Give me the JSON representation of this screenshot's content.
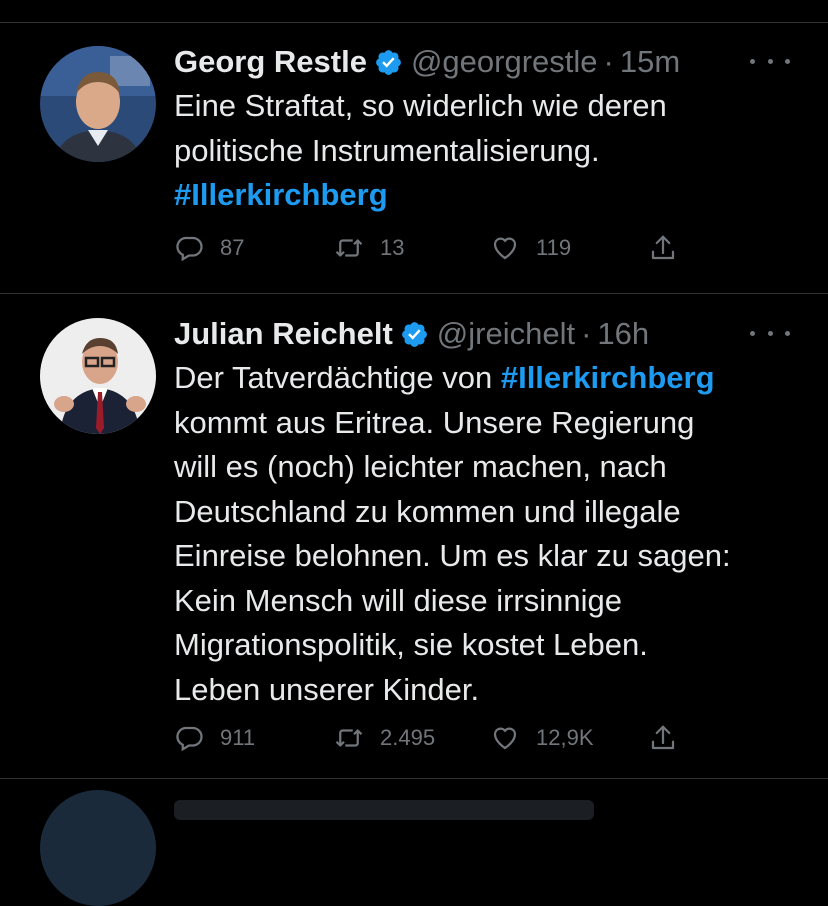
{
  "colors": {
    "background": "#000000",
    "text": "#e7e9ea",
    "muted": "#71767b",
    "accent": "#1d9bf0",
    "divider": "#2f3336"
  },
  "tweets": [
    {
      "name": "Georg Restle",
      "handle": "@georgrestle",
      "separator": "·",
      "time": "15m",
      "verified_icon": "verified-badge-icon",
      "body": {
        "line1": "Eine Straftat, so widerlich wie deren",
        "line2": "politische Instrumentalisierung.",
        "hashtag": "#Illerkirchberg"
      },
      "actions": {
        "reply_icon": "reply-icon",
        "replies": "87",
        "retweet_icon": "retweet-icon",
        "retweets": "13",
        "like_icon": "heart-icon",
        "likes": "119",
        "share_icon": "share-icon"
      }
    },
    {
      "name": "Julian Reichelt",
      "handle": "@jreichelt",
      "separator": "·",
      "time": "16h",
      "verified_icon": "verified-badge-icon",
      "body": {
        "line1_prefix": "Der Tatverdächtige von ",
        "line1_hashtag": "#Illerkirchberg",
        "line2": "kommt aus Eritrea. Unsere Regierung",
        "line3": "will es (noch) leichter machen, nach",
        "line4": "Deutschland zu kommen und illegale",
        "line5": "Einreise belohnen. Um es klar zu sagen:",
        "line6": "Kein Mensch will diese irrsinnige",
        "line7": "Migrationspolitik, sie kostet Leben.",
        "line8": "Leben unserer Kinder."
      },
      "actions": {
        "reply_icon": "reply-icon",
        "replies": "911",
        "retweet_icon": "retweet-icon",
        "retweets": "2.495",
        "like_icon": "heart-icon",
        "likes": "12,9K",
        "share_icon": "share-icon"
      }
    }
  ]
}
